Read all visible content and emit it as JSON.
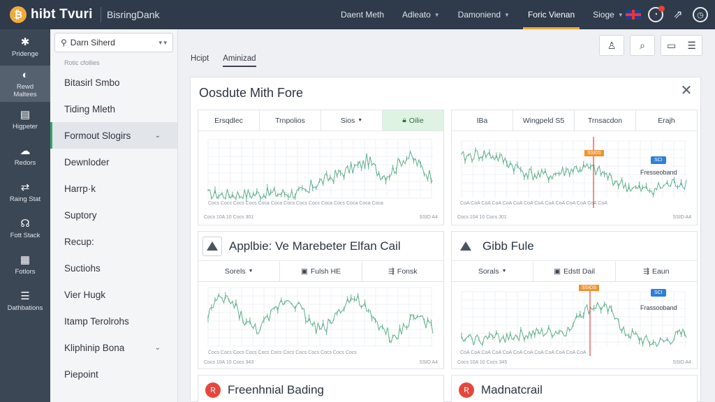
{
  "topbar": {
    "brand": "hibt Tvuri",
    "app_name": "BisringDank",
    "nav": [
      {
        "label": "Daent Meth",
        "caret": false,
        "active": false
      },
      {
        "label": "Adleato",
        "caret": true,
        "active": false
      },
      {
        "label": "Damoniend",
        "caret": true,
        "active": false
      },
      {
        "label": "Foric Vienan",
        "caret": false,
        "active": true
      },
      {
        "label": "Sioge",
        "caret": true,
        "active": false
      }
    ]
  },
  "rail": [
    {
      "label": "Pridenge",
      "icon": "gear-icon"
    },
    {
      "label": "Rewd\nMaltees",
      "icon": "coin-icon",
      "active": true
    },
    {
      "label": "Higpeter",
      "icon": "layers-icon"
    },
    {
      "label": "Redors",
      "icon": "cloud-icon"
    },
    {
      "label": "Raing Stat",
      "icon": "swap-icon"
    },
    {
      "label": "Fott Stack",
      "icon": "headset-icon"
    },
    {
      "label": "Fotlors",
      "icon": "grid-icon"
    },
    {
      "label": "Dathbations",
      "icon": "stack-icon"
    }
  ],
  "menu": {
    "search_value": "Darn Siherd",
    "caption": "Rotic cfollies",
    "items": [
      {
        "label": "Bitasirl Smbo",
        "chevron": false,
        "active": false
      },
      {
        "label": "Tiding Mleth",
        "chevron": false,
        "active": false
      },
      {
        "label": "Formout Slogirs",
        "chevron": true,
        "active": true
      },
      {
        "label": "Dewnloder",
        "chevron": false,
        "active": false
      },
      {
        "label": "Harrp·k",
        "chevron": false,
        "active": false
      },
      {
        "label": "Suptory",
        "chevron": false,
        "active": false
      },
      {
        "label": "Recup:",
        "chevron": false,
        "active": false
      },
      {
        "label": "Suctiohs",
        "chevron": false,
        "active": false
      },
      {
        "label": "Vier Hugk",
        "chevron": false,
        "active": false
      },
      {
        "label": "Itamp Terolrohs",
        "chevron": false,
        "active": false
      },
      {
        "label": "Kliphinip Bona",
        "chevron": true,
        "active": false
      },
      {
        "label": "Piepoint",
        "chevron": false,
        "active": false
      }
    ]
  },
  "main": {
    "tabs": [
      {
        "label": "Hcipt",
        "active": false
      },
      {
        "label": "Aminizad",
        "active": true
      }
    ],
    "panel_title": "Oosdute Mith Fore",
    "card1": {
      "tabs": [
        {
          "label": "Ersqdlec",
          "caret": false
        },
        {
          "label": "Trnpolios",
          "caret": false
        },
        {
          "label": "Sios",
          "caret": true
        },
        {
          "label": "Oilie",
          "caret": false,
          "green": true
        }
      ],
      "ticks": "Cocs  Cocs  Cocs  Cocs  Coca  Coca  Cocs  Cocs  Cocs  Coca  Cocs  Coca  Coca  Coca",
      "footer_left": "Cocs 10A  10 Cocs 301",
      "footer_right": "SSID A4"
    },
    "card2": {
      "tabs": [
        {
          "label": "IBa"
        },
        {
          "label": "Wingpeld S5"
        },
        {
          "label": "Trnsacdon"
        },
        {
          "label": "Erajh"
        }
      ],
      "marker_orange": "SSI0S",
      "marker_blue": "SCI",
      "annotation": "Fresseoband",
      "ticks": "CoA  CoA  CoA  CoA  CoA  CoA  CoA  CoA  CoA  CoA  CoA  CoA  CoA  CoA",
      "footer_left": "Cocs 104  10 Cocs 301",
      "footer_right": "SSID A4"
    },
    "card3": {
      "title": "Applbie: Ve Marebeter  Elfan Cail",
      "subtabs": [
        {
          "label": "Sorels",
          "caret": true
        },
        {
          "label": "Fulsh HE"
        },
        {
          "label": "Fonsk"
        }
      ],
      "ticks": "Cocs  Cocs  Cocs  Cocs  Cocs  Cocs  Cocs  Cocs  Cocs  Cocs  Cocs  Cocs",
      "footer_left": "Cocs 10A  10 Cocs 343",
      "footer_right": "SSID A4"
    },
    "card4": {
      "title": "Gibb Fule",
      "subtabs": [
        {
          "label": "Sorals",
          "caret": true
        },
        {
          "label": "Edstt Dail"
        },
        {
          "label": "Eaun"
        }
      ],
      "marker_orange": "SSIOS",
      "marker_blue": "SCI",
      "annotation": "Frassooband",
      "ticks": "CoA  CoA  CoA  CoA  CoA  CoA  CoA  CoA  CoA  CoA  CoA  CoA",
      "footer_left": "Cocs 10A  10 Cocs 345",
      "footer_right": "SSID A4"
    },
    "card5": {
      "title": "Freenhnial Bading"
    },
    "card6": {
      "title": "Madnatcrail"
    }
  },
  "colors": {
    "accent": "#f2a93b",
    "line": "#5fb08c",
    "topbar": "#2f3a4a",
    "rail": "#3c4756",
    "alert_red": "#e5473d",
    "marker_blue": "#2f7fd8",
    "marker_orange": "#f0922e"
  }
}
